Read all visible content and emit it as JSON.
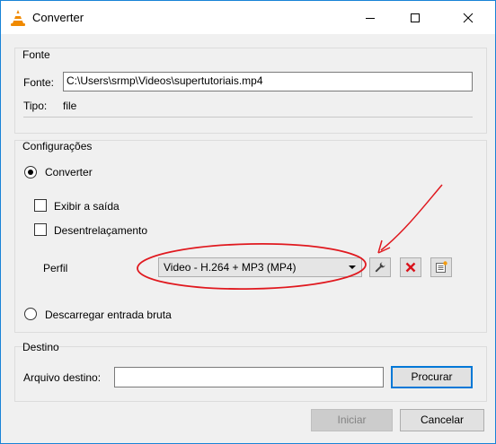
{
  "window": {
    "title": "Converter"
  },
  "source": {
    "group_label": "Fonte",
    "source_label": "Fonte:",
    "source_value": "C:\\Users\\srmp\\Videos\\supertutoriais.mp4",
    "type_label": "Tipo:",
    "type_value": "file"
  },
  "settings": {
    "group_label": "Configurações",
    "convert_label": "Converter",
    "convert_selected": true,
    "show_output_label": "Exibir a saída",
    "show_output_checked": false,
    "deinterlace_label": "Desentrelaçamento",
    "deinterlace_checked": false,
    "profile_label": "Perfil",
    "profile_value": "Video - H.264 + MP3 (MP4)",
    "raw_dump_label": "Descarregar entrada bruta",
    "raw_dump_selected": false
  },
  "destination": {
    "group_label": "Destino",
    "file_label": "Arquivo destino:",
    "file_value": "",
    "browse_label": "Procurar"
  },
  "footer": {
    "start_label": "Iniciar",
    "start_enabled": false,
    "cancel_label": "Cancelar"
  },
  "colors": {
    "annotation": "#e0191f",
    "accent": "#0078d7",
    "delete_icon": "#d9121b"
  },
  "icons": {
    "app": "vlc-cone-icon",
    "edit_profile": "wrench-icon",
    "delete_profile": "red-x-icon",
    "new_profile": "list-new-icon"
  }
}
